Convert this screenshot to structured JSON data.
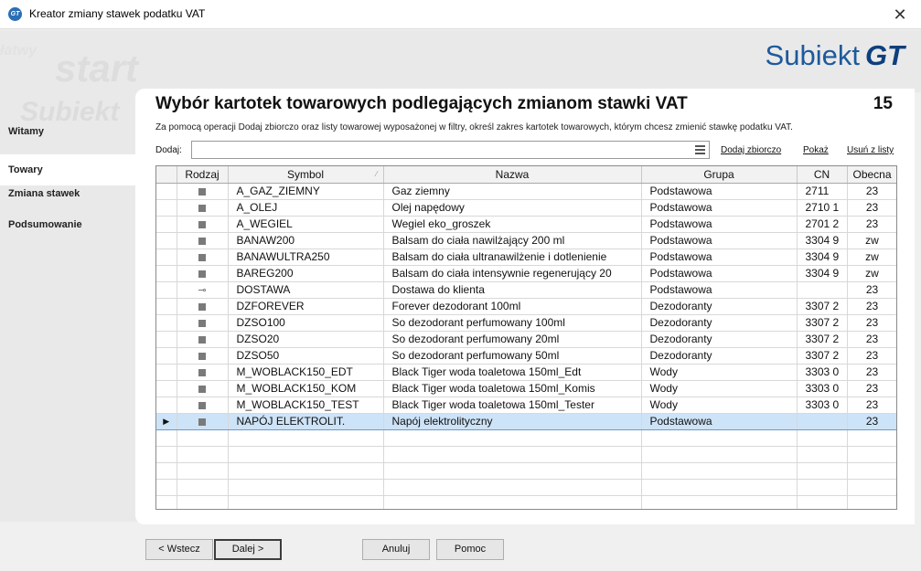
{
  "window": {
    "title": "Kreator zmiany stawek podatku VAT",
    "app_icon_text": "GT",
    "close_symbol": "✕"
  },
  "branding": {
    "logo_text": "Subiekt",
    "logo_suffix": "GT",
    "watermark_start": "start",
    "watermark_latw": "łatwy",
    "watermark_subiekt": "Subiekt"
  },
  "sidebar": {
    "items": [
      {
        "label": "Witamy",
        "active": false
      },
      {
        "label": "Towary",
        "active": true
      },
      {
        "label": "Zmiana stawek",
        "active": false
      },
      {
        "label": "Podsumowanie",
        "active": false
      }
    ]
  },
  "main": {
    "title": "Wybór kartotek towarowych podlegających zmianom stawki VAT",
    "page_number": "15",
    "description": "Za pomocą operacji Dodaj zbiorczo oraz listy towarowej wyposażonej w filtry, określ zakres kartotek towarowych, którym chcesz zmienić stawkę podatku VAT.",
    "add_label": "Dodaj:",
    "add_value": "",
    "links": {
      "bulk_add": "Dodaj zbiorczo",
      "show": "Pokaż",
      "remove": "Usuń z listy"
    }
  },
  "table": {
    "columns": [
      "",
      "Rodzaj",
      "Symbol",
      "Nazwa",
      "Grupa",
      "CN",
      "Obecna"
    ],
    "rows": [
      {
        "type": "square",
        "symbol": "A_GAZ_ZIEMNY",
        "name": "Gaz ziemny",
        "group": "Podstawowa",
        "cn": "2711",
        "vat": "23"
      },
      {
        "type": "square",
        "symbol": "A_OLEJ",
        "name": "Olej napędowy",
        "group": "Podstawowa",
        "cn": "2710 1",
        "vat": "23"
      },
      {
        "type": "square",
        "symbol": "A_WEGIEL",
        "name": "Wegiel eko_groszek",
        "group": "Podstawowa",
        "cn": "2701 2",
        "vat": "23"
      },
      {
        "type": "square",
        "symbol": "BANAW200",
        "name": "Balsam do ciała nawilżający 200 ml",
        "group": "Podstawowa",
        "cn": "3304 9",
        "vat": "zw"
      },
      {
        "type": "square",
        "symbol": "BANAWULTRA250",
        "name": "Balsam do ciała ultranawilżenie i dotlenienie",
        "group": "Podstawowa",
        "cn": "3304 9",
        "vat": "zw"
      },
      {
        "type": "square",
        "symbol": "BAREG200",
        "name": "Balsam do ciała intensywnie regenerujący 20",
        "group": "Podstawowa",
        "cn": "3304 9",
        "vat": "zw"
      },
      {
        "type": "wrench",
        "symbol": "DOSTAWA",
        "name": "Dostawa do klienta",
        "group": "Podstawowa",
        "cn": "",
        "vat": "23"
      },
      {
        "type": "square",
        "symbol": "DZFOREVER",
        "name": "Forever dezodorant 100ml",
        "group": "Dezodoranty",
        "cn": "3307 2",
        "vat": "23"
      },
      {
        "type": "square",
        "symbol": "DZSO100",
        "name": "So dezodorant perfumowany 100ml",
        "group": "Dezodoranty",
        "cn": "3307 2",
        "vat": "23"
      },
      {
        "type": "square",
        "symbol": "DZSO20",
        "name": "So dezodorant perfumowany 20ml",
        "group": "Dezodoranty",
        "cn": "3307 2",
        "vat": "23"
      },
      {
        "type": "square",
        "symbol": "DZSO50",
        "name": "So dezodorant perfumowany 50ml",
        "group": "Dezodoranty",
        "cn": "3307 2",
        "vat": "23"
      },
      {
        "type": "square",
        "symbol": "M_WOBLACK150_EDT",
        "name": "Black Tiger woda toaletowa 150ml_Edt",
        "group": "Wody",
        "cn": "3303 0",
        "vat": "23"
      },
      {
        "type": "square",
        "symbol": "M_WOBLACK150_KOM",
        "name": "Black Tiger woda toaletowa 150ml_Komis",
        "group": "Wody",
        "cn": "3303 0",
        "vat": "23"
      },
      {
        "type": "square",
        "symbol": "M_WOBLACK150_TEST",
        "name": "Black Tiger woda toaletowa 150ml_Tester",
        "group": "Wody",
        "cn": "3303 0",
        "vat": "23"
      },
      {
        "type": "square",
        "symbol": "NAPÓJ ELEKTROLIT.",
        "name": "Napój elektrolityczny",
        "group": "Podstawowa",
        "cn": "",
        "vat": "23",
        "selected": true
      }
    ],
    "empty_rows": 5,
    "current_row_indicator": "▶",
    "sort_indicator": "⁄"
  },
  "buttons": {
    "back": "< Wstecz",
    "next": "Dalej >",
    "cancel": "Anuluj",
    "help": "Pomoc"
  }
}
